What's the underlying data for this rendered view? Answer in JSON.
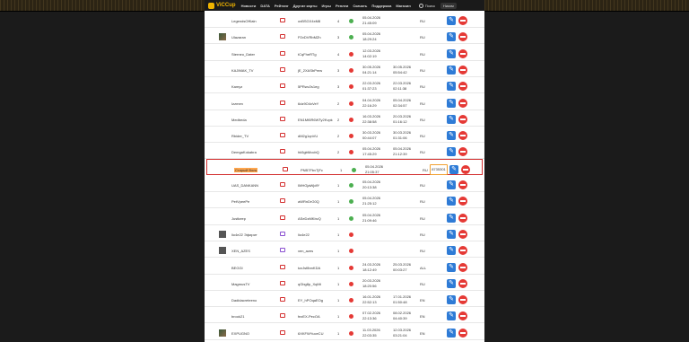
{
  "header": {
    "logo_text": "ViCCup",
    "nav": [
      "Новости",
      "DATA",
      "Рейтинг",
      "Другие карты",
      "Игры",
      "Реплеи",
      "Скачать",
      "Поддержка",
      "Магазин"
    ],
    "search_label": "Поиск",
    "user_label": "Ником"
  },
  "rows": [
    {
      "name": "LegendsOfKain",
      "code": "oxBSGX4xM8",
      "num": "4",
      "status": "on",
      "d1": [
        "05.04.2026",
        "21:45:09"
      ],
      "d2": [],
      "lang": "RU",
      "note": "",
      "avatar": "none",
      "icon": "red"
    },
    {
      "name": "Ulazaran",
      "code": "P2vDVRbMZh",
      "num": "3",
      "status": "on",
      "d1": [
        "05.04.2026",
        "18:29:24"
      ],
      "d2": [],
      "lang": "RU",
      "note": "",
      "avatar": "colored",
      "icon": "red"
    },
    {
      "name": "Sterneo_Dater",
      "code": "tCqFheRTg",
      "num": "4",
      "status": "off",
      "d1": [
        "12.03.2026",
        "14:02:19"
      ],
      "d2": [],
      "lang": "RU",
      "note": "",
      "avatar": "none",
      "icon": "red"
    },
    {
      "name": "KAJIMAK_TV",
      "code": "jE_2XASbPmw",
      "num": "3",
      "status": "off",
      "d1": [
        "30.05.2026",
        "04:21:14"
      ],
      "d2": [
        "30.05.2026",
        "05:54:42"
      ],
      "lang": "RU",
      "note": "",
      "avatar": "none",
      "icon": "red"
    },
    {
      "name": "Kamyz",
      "code": "5PRwv2s1eg",
      "num": "3",
      "status": "off",
      "d1": [
        "22.03.2026",
        "01:37:23"
      ],
      "d2": [
        "22.03.2026",
        "02:11:38"
      ],
      "lang": "RU",
      "note": "",
      "avatar": "none",
      "icon": "red"
    },
    {
      "name": "Izzmen",
      "code": "6dz9O4xVeY",
      "num": "2",
      "status": "off",
      "d1": [
        "04.04.2026",
        "22:16:29"
      ],
      "d2": [
        "05.04.2026",
        "02:34:57"
      ],
      "lang": "RU",
      "note": "",
      "avatar": "none",
      "icon": "red"
    },
    {
      "name": "Medbeda",
      "code": "EN1Mt5R6WTy2Kvpk",
      "num": "2",
      "status": "off",
      "d1": [
        "16.03.2026",
        "22:38:58"
      ],
      "d2": [
        "20.03.2026",
        "01:16:12"
      ],
      "lang": "RU",
      "note": "",
      "avatar": "none",
      "icon": "red"
    },
    {
      "name": "Rbider_TV",
      "code": "dM2g1qnVU",
      "num": "2",
      "status": "off",
      "d1": [
        "30.03.2026",
        "00:44:07"
      ],
      "d2": [
        "30.03.2026",
        "01:31:06"
      ],
      "lang": "RU",
      "note": "",
      "avatar": "none",
      "icon": "red"
    },
    {
      "name": "DemgaKokabra",
      "code": "hk5gbMocbQ",
      "num": "2",
      "status": "off",
      "d1": [
        "05.04.2026",
        "17:45:29"
      ],
      "d2": [
        "05.04.2026",
        "21:12:39"
      ],
      "lang": "RU",
      "note": "",
      "avatar": "none",
      "icon": "red"
    },
    {
      "name": "Старый Волк",
      "code": "PNB7FbvTjFc",
      "num": "1",
      "status": "on",
      "d1": [
        "05.04.2026",
        "21:05:37"
      ],
      "d2": [],
      "lang": "RU",
      "note": "8735301",
      "avatar": "none",
      "icon": "red",
      "highlight": true
    },
    {
      "name": "UAS_DANKANN",
      "code": "IMHGjaWjdfY",
      "num": "1",
      "status": "on",
      "d1": [
        "05.04.2026",
        "20:13:38"
      ],
      "d2": [],
      "lang": "RU",
      "note": "",
      "avatar": "none",
      "icon": "red"
    },
    {
      "name": "PetVpeePe",
      "code": "aWRnDrG0Q",
      "num": "1",
      "status": "on",
      "d1": [
        "05.04.2026",
        "21:25:12"
      ],
      "d2": [],
      "lang": "RU",
      "note": "",
      "avatar": "none",
      "icon": "red"
    },
    {
      "name": "Justkeep",
      "code": "ASeDzMKbvQ",
      "num": "1",
      "status": "on",
      "d1": [
        "05.04.2026",
        "21:09:46"
      ],
      "d2": [],
      "lang": "RU",
      "note": "",
      "avatar": "none",
      "icon": "red"
    },
    {
      "name": "lio4e22 Эфирит",
      "code": "lio4e22",
      "num": "1",
      "status": "off",
      "d1": [],
      "d2": [],
      "lang": "RU",
      "note": "",
      "avatar": "dark",
      "icon": "purple"
    },
    {
      "name": "XEN_AZES",
      "code": "xen_azes",
      "num": "1",
      "status": "off",
      "d1": [],
      "d2": [],
      "lang": "RU",
      "note": "",
      "avatar": "dark",
      "icon": "purple"
    },
    {
      "name": "BEGGI",
      "code": "tzzJsf8nnKDA",
      "num": "1",
      "status": "off",
      "d1": [
        "24.03.2026",
        "18:12:49"
      ],
      "d2": [
        "25.03.2026",
        "00:03:27"
      ],
      "lang": "ALL",
      "note": "",
      "avatar": "none",
      "icon": "red"
    },
    {
      "name": "MagmusTV",
      "code": "qGbg8p_XqMt",
      "num": "1",
      "status": "off",
      "d1": [
        "20.03.2026",
        "18:20:56"
      ],
      "d2": [],
      "lang": "RU",
      "note": "",
      "avatar": "none",
      "icon": "red"
    },
    {
      "name": "Dadidacreteeno",
      "code": "EY_hPOqaEOg",
      "num": "1",
      "status": "off",
      "d1": [
        "16.01.2026",
        "22:52:13"
      ],
      "d2": [
        "17.01.2026",
        "01:50:48"
      ],
      "lang": "EN",
      "note": "",
      "avatar": "none",
      "icon": "red"
    },
    {
      "name": "brook21",
      "code": "fezEX-PecOA",
      "num": "1",
      "status": "off",
      "d1": [
        "07.02.2026",
        "22:13:36"
      ],
      "d2": [
        "08.02.2026",
        "04:40:39"
      ],
      "lang": "EN",
      "note": "",
      "avatar": "none",
      "icon": "red"
    },
    {
      "name": "EXPUGNO",
      "code": "6XKFWYuceCU",
      "num": "1",
      "status": "off",
      "d1": [
        "11.03.2026",
        "22:03:35"
      ],
      "d2": [
        "12.03.2026",
        "03:21:04"
      ],
      "lang": "EN",
      "note": "",
      "avatar": "colored",
      "icon": "red"
    }
  ]
}
